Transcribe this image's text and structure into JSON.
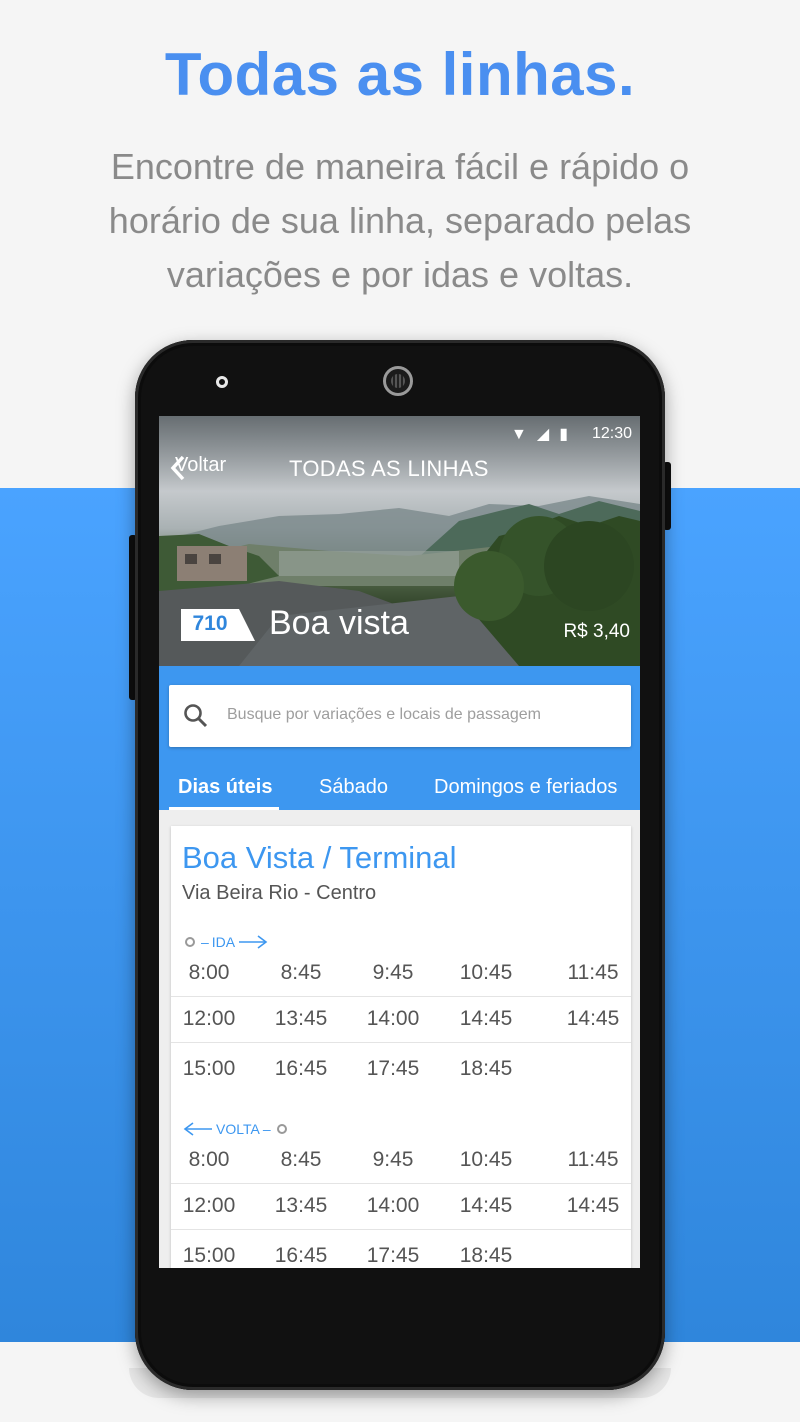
{
  "promo": {
    "headline": "Todas as linhas.",
    "subtitle": "Encontre de maneira fácil e rápido o horário de sua linha, separado pelas variações e por idas e voltas."
  },
  "colors": {
    "accent": "#4a8ff0",
    "app_blue": "#3d97f0",
    "band_top": "#4aa3ff",
    "band_bottom": "#2f86dc"
  },
  "status_bar": {
    "icons": "wifi-icon signal-icon battery-icon",
    "wifi_glyph": "▼",
    "signal_glyph": "◢",
    "battery_glyph": "▮",
    "time": "12:30"
  },
  "header": {
    "back_label": "Voltar",
    "title": "TODAS AS LINHAS",
    "line_number": "710",
    "line_name": "Boa vista",
    "fare": "R$ 3,40"
  },
  "search": {
    "placeholder": "Busque por variações e locais de passagem"
  },
  "tabs": [
    {
      "label": "Dias úteis",
      "active": true
    },
    {
      "label": "Sábado",
      "active": false
    },
    {
      "label": "Domingos e feriados",
      "active": false
    }
  ],
  "card": {
    "title": "Boa Vista / Terminal",
    "subtitle": "Via Beira Rio - Centro",
    "ida": {
      "label": "IDA",
      "rows": [
        [
          "8:00",
          "8:45",
          "9:45",
          "10:45",
          "11:45"
        ],
        [
          "12:00",
          "13:45",
          "14:00",
          "14:45",
          "14:45"
        ],
        [
          "15:00",
          "16:45",
          "17:45",
          "18:45",
          ""
        ]
      ]
    },
    "volta": {
      "label": "VOLTA",
      "rows": [
        [
          "8:00",
          "8:45",
          "9:45",
          "10:45",
          "11:45"
        ],
        [
          "12:00",
          "13:45",
          "14:00",
          "14:45",
          "14:45"
        ],
        [
          "15:00",
          "16:45",
          "17:45",
          "18:45",
          ""
        ]
      ]
    }
  }
}
